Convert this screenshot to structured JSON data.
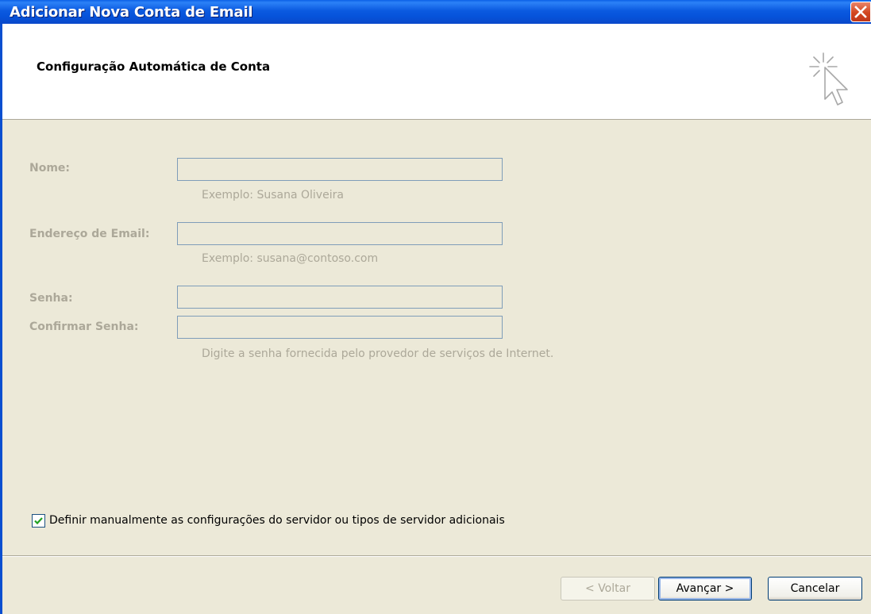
{
  "window": {
    "title": "Adicionar Nova Conta de Email",
    "close_icon": "close-icon"
  },
  "header": {
    "title": "Configuração Automática de Conta",
    "icon": "wizard-cursor-icon"
  },
  "form": {
    "name": {
      "label": "Nome:",
      "value": "",
      "hint": "Exemplo: Susana Oliveira",
      "enabled": false
    },
    "email": {
      "label": "Endereço de Email:",
      "value": "",
      "hint": "Exemplo: susana@contoso.com",
      "enabled": false
    },
    "password": {
      "label": "Senha:",
      "value": "",
      "enabled": false
    },
    "confirm_password": {
      "label": "Confirmar Senha:",
      "value": "",
      "enabled": false
    },
    "password_hint": "Digite a senha fornecida pelo provedor de serviços de Internet."
  },
  "manual_config": {
    "label": "Definir manualmente as configurações do servidor ou tipos de servidor adicionais",
    "checked": true
  },
  "buttons": {
    "back": "< Voltar",
    "next": "Avançar >",
    "cancel": "Cancelar"
  },
  "colors": {
    "titlebar": "#0A5FE6",
    "dialog_background": "#ECE9D8",
    "disabled_text": "#ACA899",
    "close_button": "#D2461F"
  }
}
